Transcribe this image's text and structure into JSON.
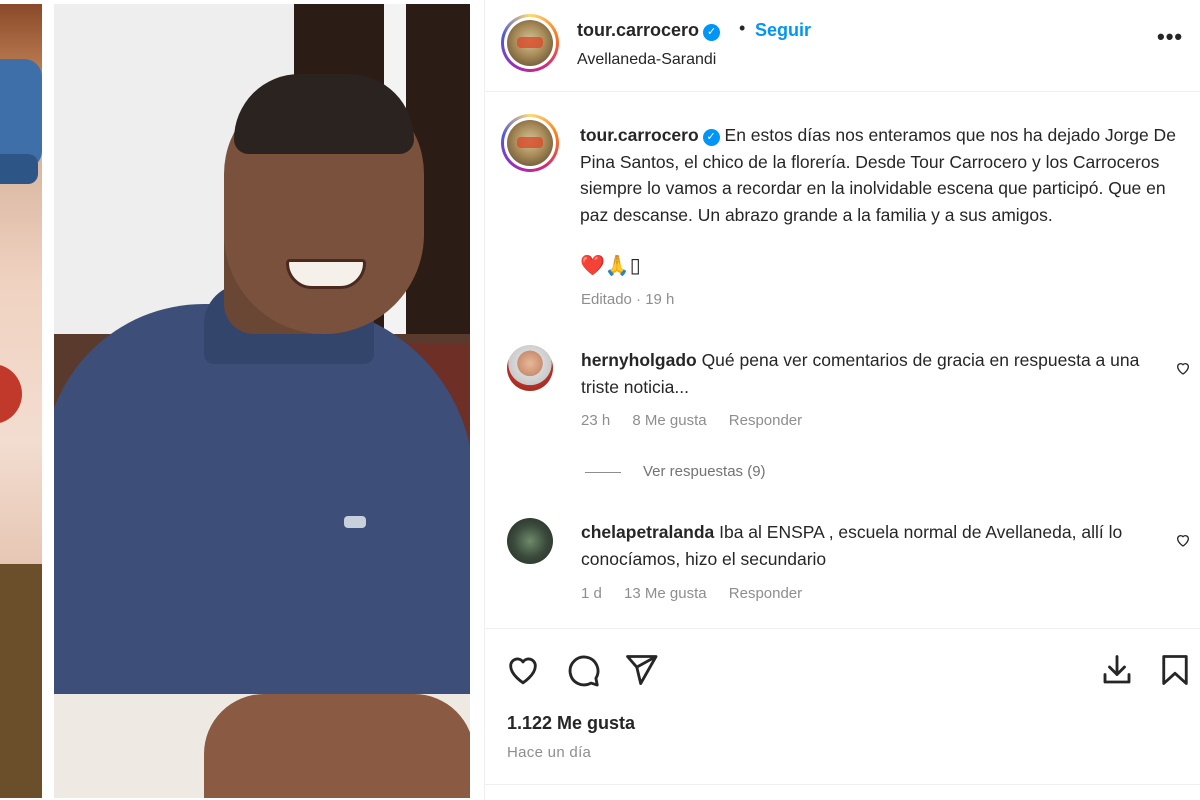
{
  "post": {
    "username": "tour.carrocero",
    "follow_label": "Seguir",
    "separator": "•",
    "location": "Avellaneda-Sarandi",
    "more_label": "•••"
  },
  "caption": {
    "username": "tour.carrocero",
    "text": " En estos días nos enteramos que nos ha dejado Jorge De Pina Santos, el chico de la florería. Desde Tour Carrocero y los Carroceros siempre lo vamos a recordar en la inolvidable escena que participó. Que en paz descanse. Un abrazo grande a la familia y a sus amigos.",
    "emojis": "❤️🙏▯",
    "edited": "Editado · 19 h"
  },
  "comments": [
    {
      "username": "hernyholgado",
      "text": " Qué pena ver comentarios de gracia en respuesta a una triste noticia...",
      "time": "23 h",
      "likes": "8 Me gusta",
      "reply": "Responder"
    },
    {
      "username": "chelapetralanda",
      "text": " Iba al ENSPA , escuela normal de Avellaneda, allí lo conocíamos, hizo el secundario",
      "time": "1 d",
      "likes": "13 Me gusta",
      "reply": "Responder"
    }
  ],
  "view_replies": "Ver respuestas (9)",
  "stats": {
    "likes": "1.122 Me gusta",
    "time": "Hace un día"
  },
  "icons": {
    "like": "heart-icon",
    "comment": "comment-icon",
    "share": "share-icon",
    "download": "download-icon",
    "save": "bookmark-icon",
    "verified": "verified-badge-icon"
  },
  "colors": {
    "link_blue": "#0095f6",
    "verified_blue": "#0095f6",
    "muted_text": "#8e8e8e",
    "primary_text": "#262626"
  }
}
